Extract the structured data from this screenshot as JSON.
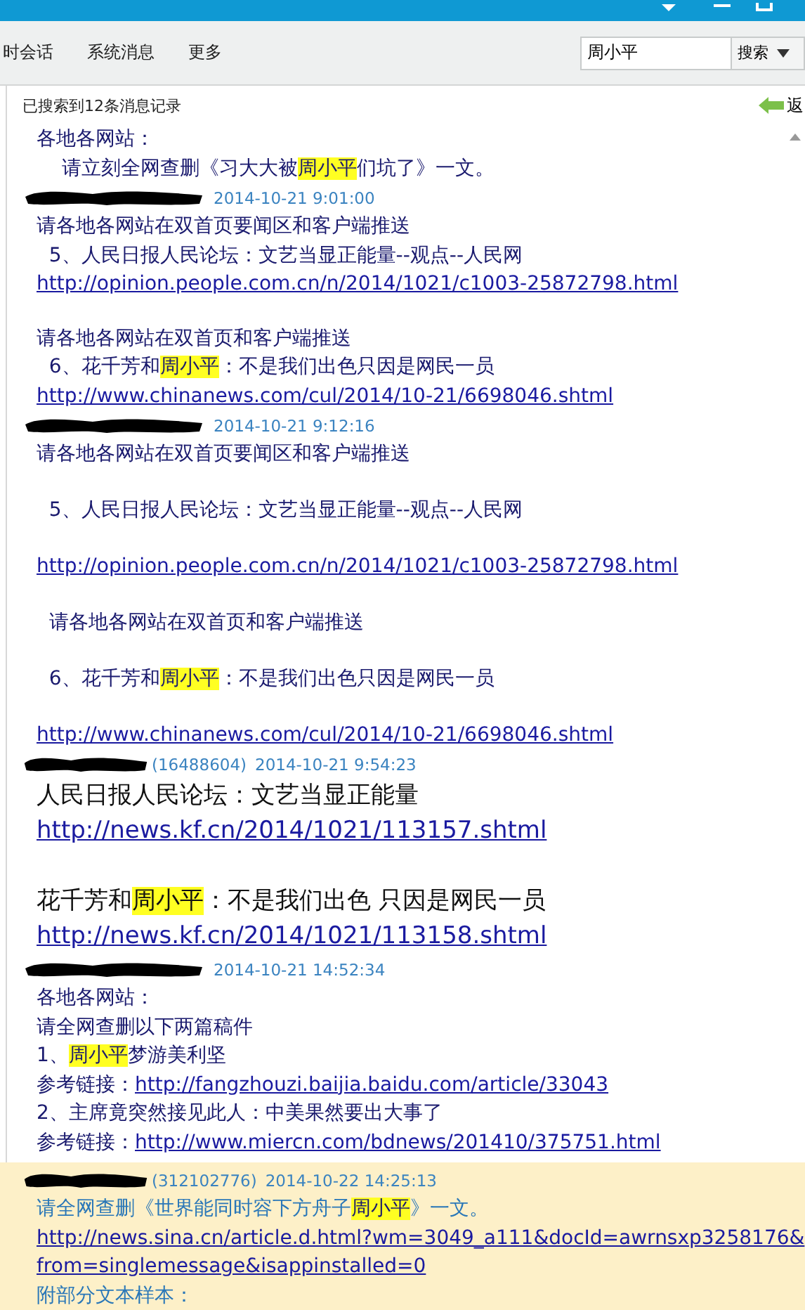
{
  "toolbar": {
    "tabs": [
      {
        "label": "时会话",
        "selected": false
      },
      {
        "label": "系统消息",
        "selected": false
      },
      {
        "label": "更多",
        "selected": false
      }
    ],
    "search": {
      "value": "周小平",
      "button": "搜索"
    }
  },
  "status": {
    "text": "已搜索到12条消息记录",
    "back": "返"
  },
  "messages": [
    {
      "kind": "standard",
      "selected": false,
      "lines": [
        {
          "kind": "line",
          "parts": [
            {
              "kind": "text",
              "text": "各地各网站："
            }
          ]
        },
        {
          "kind": "line",
          "parts": [
            {
              "kind": "text",
              "text": "    请立刻全网查删《习大大被"
            },
            {
              "kind": "keyword",
              "text": "周小平"
            },
            {
              "kind": "text",
              "text": "们坑了》一文。"
            }
          ]
        }
      ]
    },
    {
      "kind": "standard",
      "selected": false,
      "header": {
        "time": "2014-10-21 9:01:00"
      },
      "lines": [
        {
          "kind": "line",
          "parts": [
            {
              "kind": "text",
              "text": "请各地各网站在双首页要闻区和客户端推送"
            }
          ]
        },
        {
          "kind": "line",
          "parts": [
            {
              "kind": "text",
              "text": "  5、人民日报人民论坛：文艺当显正能量--观点--人民网"
            }
          ]
        },
        {
          "kind": "line",
          "parts": [
            {
              "kind": "link",
              "text": "http://opinion.people.com.cn/n/2014/1021/c1003-25872798.html"
            }
          ]
        },
        {
          "kind": "after_blank",
          "parts": [
            {
              "kind": "text",
              "text": "请各地各网站在双首页和客户端推送"
            }
          ]
        },
        {
          "kind": "line",
          "parts": [
            {
              "kind": "text",
              "text": "  6、花千芳和"
            },
            {
              "kind": "keyword",
              "text": "周小平"
            },
            {
              "kind": "text",
              "text": "：不是我们出色只因是网民一员"
            }
          ]
        },
        {
          "kind": "line",
          "parts": [
            {
              "kind": "link",
              "text": "http://www.chinanews.com/cul/2014/10-21/6698046.shtml"
            }
          ]
        }
      ]
    },
    {
      "kind": "spaced",
      "selected": false,
      "header": {
        "time": "2014-10-21 9:12:16"
      },
      "lines": [
        {
          "kind": "line",
          "parts": [
            {
              "kind": "text",
              "text": "请各地各网站在双首页要闻区和客户端推送"
            }
          ]
        },
        {
          "kind": "line",
          "parts": [
            {
              "kind": "text",
              "text": "  5、人民日报人民论坛：文艺当显正能量--观点--人民网"
            }
          ]
        },
        {
          "kind": "line",
          "parts": [
            {
              "kind": "link",
              "text": "http://opinion.people.com.cn/n/2014/1021/c1003-25872798.html"
            }
          ]
        },
        {
          "kind": "line",
          "parts": [
            {
              "kind": "text",
              "text": "  请各地各网站在双首页和客户端推送"
            }
          ]
        },
        {
          "kind": "line",
          "parts": [
            {
              "kind": "text",
              "text": "  6、花千芳和"
            },
            {
              "kind": "keyword",
              "text": "周小平"
            },
            {
              "kind": "text",
              "text": "：不是我们出色只因是网民一员"
            }
          ]
        },
        {
          "kind": "line",
          "parts": [
            {
              "kind": "link",
              "text": "http://www.chinanews.com/cul/2014/10-21/6698046.shtml"
            }
          ]
        }
      ]
    },
    {
      "kind": "large",
      "selected": false,
      "header": {
        "sender": "(16488604)",
        "time": "2014-10-21 9:54:23"
      },
      "lines": [
        {
          "kind": "line",
          "parts": [
            {
              "kind": "text",
              "text": "人民日报人民论坛：文艺当显正能量"
            }
          ]
        },
        {
          "kind": "line",
          "parts": [
            {
              "kind": "link",
              "text": "http://news.kf.cn/2014/1021/113157.shtml"
            }
          ]
        },
        {
          "kind": "after_blank",
          "parts": [
            {
              "kind": "text",
              "text": "花千芳和"
            },
            {
              "kind": "keyword",
              "text": "周小平"
            },
            {
              "kind": "text",
              "text": "：不是我们出色 只因是网民一员"
            }
          ]
        },
        {
          "kind": "line",
          "parts": [
            {
              "kind": "link",
              "text": "http://news.kf.cn/2014/1021/113158.shtml"
            }
          ]
        }
      ]
    },
    {
      "kind": "standard",
      "selected": false,
      "header": {
        "time": "2014-10-21 14:52:34"
      },
      "lines": [
        {
          "kind": "line",
          "parts": [
            {
              "kind": "text",
              "text": "各地各网站："
            }
          ]
        },
        {
          "kind": "line",
          "parts": [
            {
              "kind": "text",
              "text": "请全网查删以下两篇稿件"
            }
          ]
        },
        {
          "kind": "line",
          "parts": [
            {
              "kind": "text",
              "text": "1、"
            },
            {
              "kind": "keyword",
              "text": "周小平"
            },
            {
              "kind": "text",
              "text": "梦游美利坚"
            }
          ]
        },
        {
          "kind": "line",
          "parts": [
            {
              "kind": "text",
              "text": "参考链接："
            },
            {
              "kind": "link",
              "text": "http://fangzhouzi.baijia.baidu.com/article/33043"
            }
          ]
        },
        {
          "kind": "line",
          "parts": [
            {
              "kind": "text",
              "text": "2、主席竟突然接见此人：中美果然要出大事了"
            }
          ]
        },
        {
          "kind": "line",
          "parts": [
            {
              "kind": "text",
              "text": "参考链接："
            },
            {
              "kind": "link",
              "text": "http://www.miercn.com/bdnews/201410/375751.html"
            }
          ]
        }
      ]
    },
    {
      "kind": "standard",
      "selected": true,
      "header": {
        "sender": "(312102776)",
        "time": "2014-10-22 14:25:13"
      },
      "lines": [
        {
          "kind": "line",
          "parts": [
            {
              "kind": "text",
              "text": "请全网查删《世界能同时容下方舟子"
            },
            {
              "kind": "keyword",
              "text": "周小平"
            },
            {
              "kind": "text",
              "text": "》一文。"
            }
          ]
        },
        {
          "kind": "line",
          "parts": [
            {
              "kind": "link",
              "text": "http://news.sina.cn/article.d.html?wm=3049_a111&docId=awrnsxp3258176&"
            }
          ]
        },
        {
          "kind": "line",
          "parts": [
            {
              "kind": "link",
              "text": "from=singlemessage&isappinstalled=0"
            }
          ]
        },
        {
          "kind": "line",
          "parts": [
            {
              "kind": "text",
              "text": "附部分文本样本："
            }
          ]
        }
      ]
    }
  ]
}
